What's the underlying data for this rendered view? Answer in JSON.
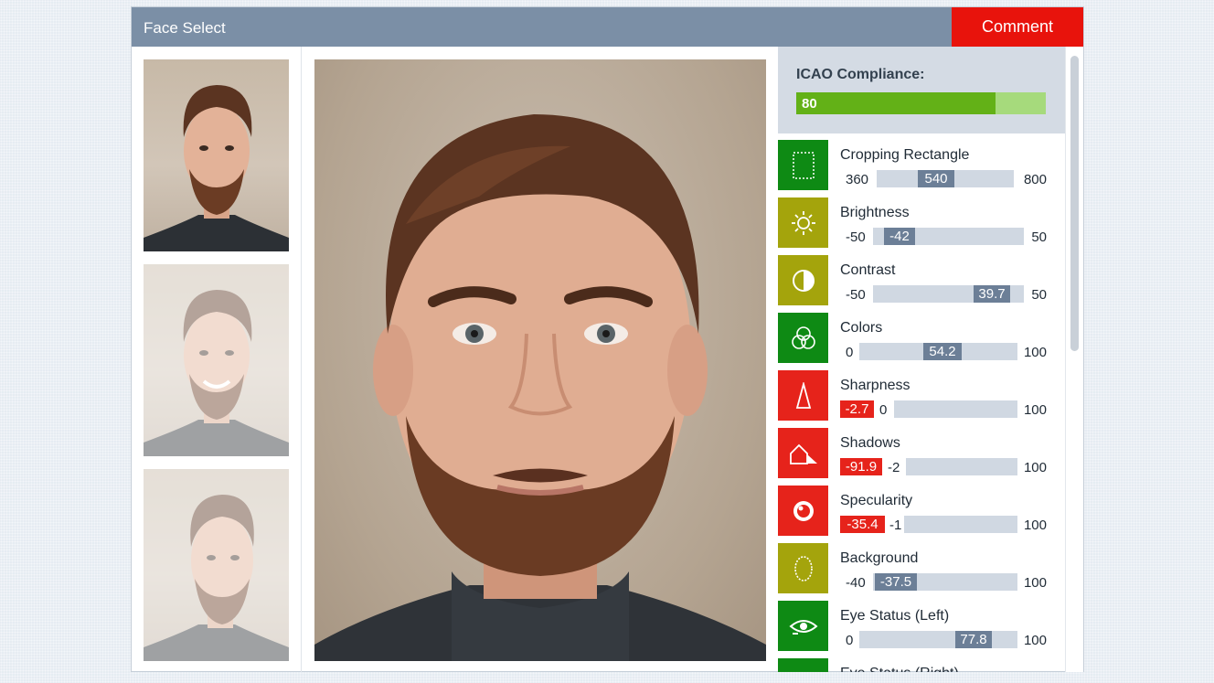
{
  "window": {
    "title": "Face Select",
    "comment_label": "Comment"
  },
  "thumbnails": [
    {
      "state": "selected"
    },
    {
      "state": "dimmed"
    },
    {
      "state": "dimmed"
    }
  ],
  "icao": {
    "label": "ICAO Compliance:",
    "value": "80",
    "fraction": 0.8
  },
  "params": [
    {
      "name": "Cropping Rectangle",
      "icon": "crop-icon",
      "color": "green",
      "min": "360",
      "max": "800",
      "value": "540",
      "badge": ""
    },
    {
      "name": "Brightness",
      "icon": "sun-icon",
      "color": "olive",
      "min": "-50",
      "max": "50",
      "value": "-42",
      "badge": ""
    },
    {
      "name": "Contrast",
      "icon": "contrast-icon",
      "color": "olive",
      "min": "-50",
      "max": "50",
      "value": "39.7",
      "badge": ""
    },
    {
      "name": "Colors",
      "icon": "color-circles-icon",
      "color": "green",
      "min": "0",
      "max": "100",
      "value": "54.2",
      "badge": ""
    },
    {
      "name": "Sharpness",
      "icon": "sharpness-icon",
      "color": "red",
      "min": "0",
      "max": "100",
      "value": "",
      "badge": "-2.7"
    },
    {
      "name": "Shadows",
      "icon": "shadow-icon",
      "color": "red",
      "min": "-2",
      "max": "100",
      "value": "",
      "badge": "-91.9"
    },
    {
      "name": "Specularity",
      "icon": "specular-icon",
      "color": "red",
      "min": "-1",
      "max": "100",
      "value": "",
      "badge": "-35.4"
    },
    {
      "name": "Background",
      "icon": "background-icon",
      "color": "olive",
      "min": "-40",
      "max": "100",
      "value": "-37.5",
      "badge": ""
    },
    {
      "name": "Eye Status (Left)",
      "icon": "eye-left-icon",
      "color": "green",
      "min": "0",
      "max": "100",
      "value": "77.8",
      "badge": ""
    },
    {
      "name": "Eye Status (Right)",
      "icon": "eye-right-icon",
      "color": "green",
      "min": "",
      "max": "",
      "value": "",
      "badge": ""
    }
  ],
  "colors": {
    "accent_red": "#e8130c",
    "titlebar": "#7b8fa6",
    "good": "#0e8a14",
    "warn": "#a4a40c",
    "bad": "#e6231b",
    "icao_green": "#63b117"
  }
}
